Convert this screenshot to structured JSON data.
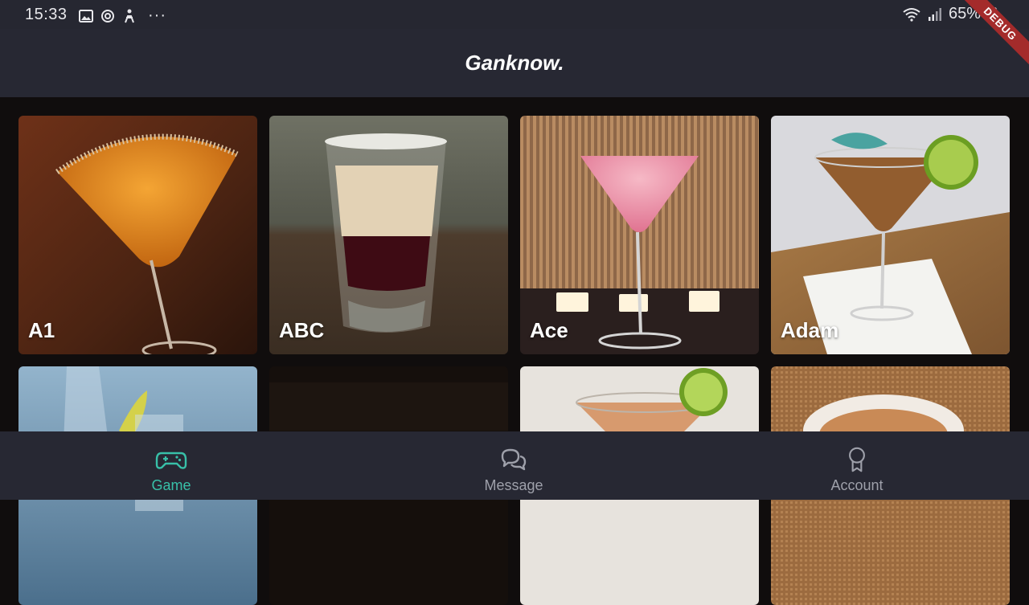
{
  "status_bar": {
    "time": "15:33",
    "battery": "65%",
    "ellipsis": "···",
    "left_icons": [
      "gallery-icon",
      "sync-icon",
      "accessibility-icon",
      "more-dots-icon"
    ],
    "right_icons": [
      "wifi-icon",
      "signal-icon",
      "battery-icon"
    ]
  },
  "debug_banner": "DEBUG",
  "app_bar": {
    "title": "Ganknow."
  },
  "cards": [
    {
      "label": "A1"
    },
    {
      "label": "ABC"
    },
    {
      "label": "Ace"
    },
    {
      "label": "Adam"
    },
    {
      "label": ""
    },
    {
      "label": ""
    },
    {
      "label": ""
    },
    {
      "label": ""
    }
  ],
  "bottom_nav": {
    "items": [
      {
        "label": "Game",
        "icon": "gamepad-icon",
        "active": true
      },
      {
        "label": "Message",
        "icon": "chat-bubbles-icon",
        "active": false
      },
      {
        "label": "Account",
        "icon": "award-ribbon-icon",
        "active": false
      }
    ]
  },
  "colors": {
    "background": "#100d0d",
    "bar": "#272833",
    "accent": "#38c0a8",
    "inactive": "#9ea0aa",
    "debug_ribbon": "#a42b2b"
  }
}
